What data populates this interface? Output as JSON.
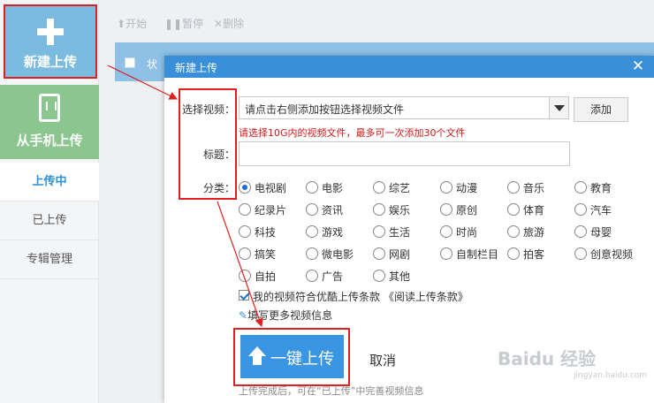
{
  "sidebar": {
    "new_upload": "新建上传",
    "phone_upload": "从手机上传",
    "items": [
      {
        "label": "上传中"
      },
      {
        "label": "已上传"
      },
      {
        "label": "专辑管理"
      }
    ]
  },
  "toolbar": {
    "start": "开始",
    "pause": "暂停",
    "delete": "删除"
  },
  "list": {
    "header_text": "状"
  },
  "dialog": {
    "title": "新建上传",
    "close_glyph": "✕",
    "video_label": "选择视频：",
    "video_placeholder": "请点击右侧添加按钮选择视频文件",
    "add_button": "添加",
    "hint": "请选择10G内的视频文件，最多可一次添加30个文件",
    "title_label": "标题：",
    "category_label": "分类：",
    "categories": [
      "电视剧",
      "电影",
      "综艺",
      "动漫",
      "音乐",
      "教育",
      "纪录片",
      "资讯",
      "娱乐",
      "原创",
      "体育",
      "汽车",
      "科技",
      "游戏",
      "生活",
      "时尚",
      "旅游",
      "母婴",
      "搞笑",
      "微电影",
      "网剧",
      "自制栏目",
      "拍客",
      "创意视频",
      "自拍",
      "广告",
      "其他"
    ],
    "selected_category": "电视剧",
    "agree_text": "我的视频符合优酷上传条款 《阅读上传条款》",
    "more_info": "填写更多视频信息",
    "upload_button": "一键上传",
    "cancel_button": "取消",
    "footnote": "上传完成后，可在“已上传”中完善视频信息"
  },
  "watermark": {
    "text": "Baidu 经验",
    "sub": "jingyan.baidu.com"
  },
  "colors": {
    "accent": "#3a8fd9",
    "annotation": "#e02020",
    "hint": "#d01818"
  }
}
